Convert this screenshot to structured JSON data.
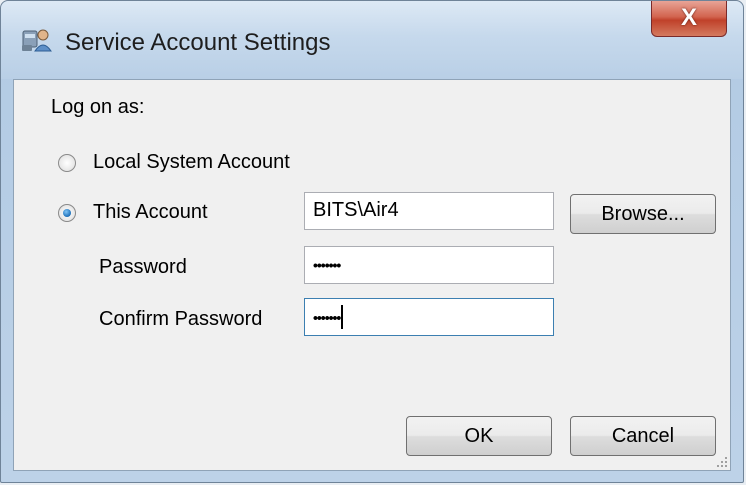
{
  "window": {
    "title": "Service Account Settings",
    "close_glyph": "X"
  },
  "form": {
    "log_on_as_label": "Log on as:",
    "local_system_label": "Local System Account",
    "this_account_label": "This Account",
    "this_account_value": "BITS\\Air4",
    "browse_label": "Browse...",
    "password_label": "Password",
    "password_value": "•••••••",
    "confirm_password_label": "Confirm Password",
    "confirm_password_value": "•••••••",
    "selected_option": "This Account"
  },
  "buttons": {
    "ok_label": "OK",
    "cancel_label": "Cancel"
  }
}
